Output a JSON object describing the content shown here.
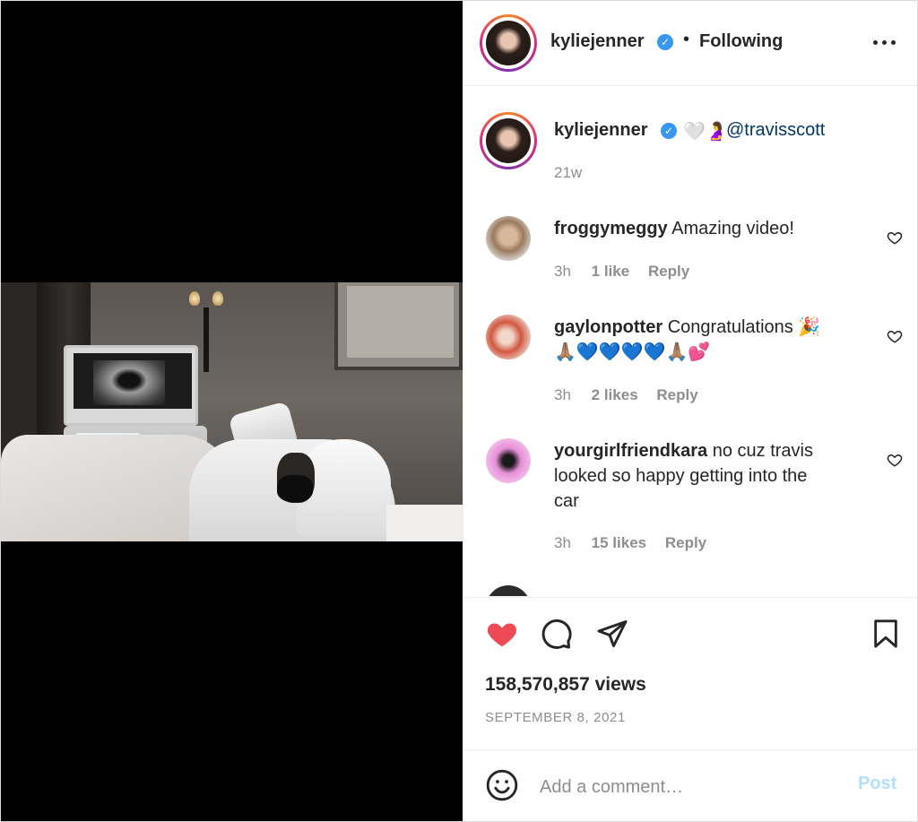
{
  "post": {
    "username": "kyliejenner",
    "following_label": "Following",
    "separator": "•"
  },
  "caption": {
    "username": "kyliejenner",
    "emoji": "🤍🤰",
    "mention": "@travisscott",
    "time": "21w"
  },
  "comments": [
    {
      "username": "froggymeggy",
      "text": "Amazing video!",
      "time": "3h",
      "likes": "1 like",
      "reply": "Reply"
    },
    {
      "username": "gaylonpotter",
      "text": "Congratulations 🎉",
      "text2": "🙏🏽💙💙💙💙🙏🏽💕",
      "time": "3h",
      "likes": "2 likes",
      "reply": "Reply"
    },
    {
      "username": "yourgirlfriendkara",
      "text": "no cuz travis",
      "text2": "looked so happy getting into the",
      "text3": "car",
      "time": "3h",
      "likes": "15 likes",
      "reply": "Reply"
    }
  ],
  "stats": {
    "views": "158,570,857 views",
    "date": "SEPTEMBER 8, 2021"
  },
  "add_comment": {
    "placeholder": "Add a comment…",
    "post_label": "Post"
  },
  "colors": {
    "like_active": "#ed4956",
    "verified": "#3897f0",
    "mention": "#00376b",
    "post_disabled": "#b2dffc"
  },
  "icons": {
    "more": "more-horizontal-icon",
    "like": "heart-filled-icon",
    "comment": "comment-bubble-icon",
    "share": "paper-plane-icon",
    "save": "bookmark-icon",
    "emoji": "smiley-icon"
  }
}
